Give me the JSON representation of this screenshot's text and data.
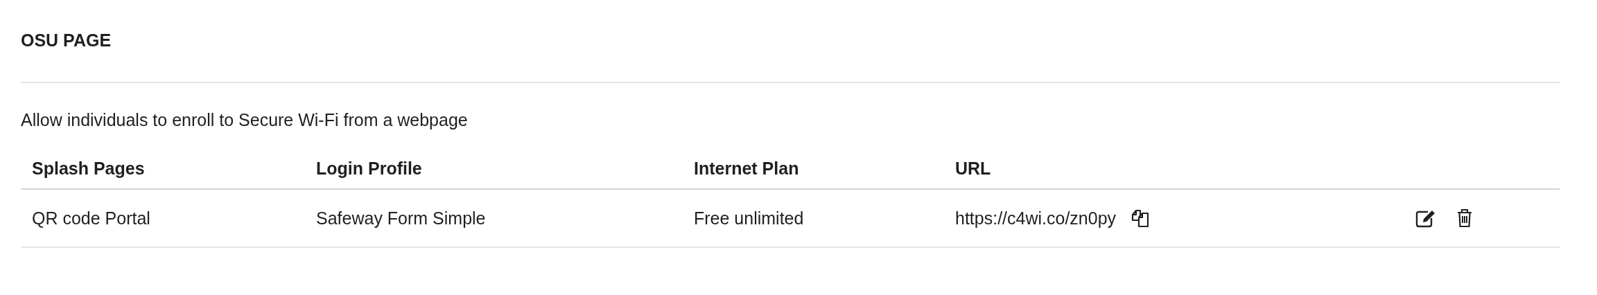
{
  "section": {
    "title": "OSU PAGE",
    "description": "Allow individuals to enroll to Secure Wi-Fi from a webpage"
  },
  "table": {
    "columns": [
      "Splash Pages",
      "Login Profile",
      "Internet Plan",
      "URL"
    ],
    "rows": [
      {
        "splash_page": "QR code Portal",
        "login_profile": "Safeway Form Simple",
        "internet_plan": "Free unlimited",
        "url": "https://c4wi.co/zn0py"
      }
    ]
  }
}
